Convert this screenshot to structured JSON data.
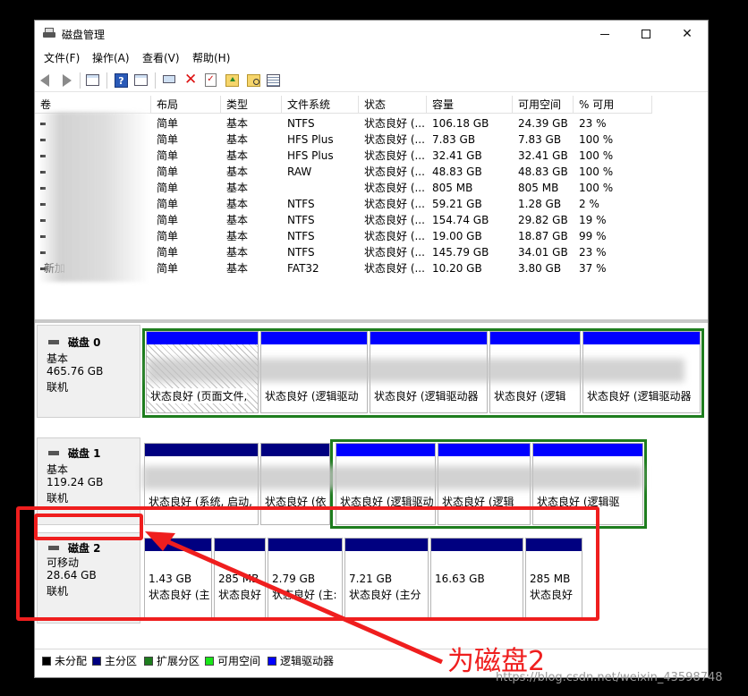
{
  "window": {
    "title": "磁盘管理"
  },
  "menu": [
    "文件(F)",
    "操作(A)",
    "查看(V)",
    "帮助(H)"
  ],
  "toolbar": [
    "back-icon",
    "forward-icon",
    "console-tree-icon",
    "help-icon",
    "properties-icon",
    "connect-icon",
    "delete-icon",
    "check-icon",
    "folder-up-icon",
    "folder-search-icon",
    "list-icon"
  ],
  "columns": [
    "卷",
    "布局",
    "类型",
    "文件系统",
    "状态",
    "容量",
    "可用空间",
    "% 可用"
  ],
  "volumes": [
    {
      "name": "",
      "layout": "简单",
      "type": "基本",
      "fs": "NTFS",
      "status": "状态良好 (...",
      "capacity": "106.18 GB",
      "free": "24.39 GB",
      "pct": "23 %"
    },
    {
      "name": "",
      "layout": "简单",
      "type": "基本",
      "fs": "HFS Plus",
      "status": "状态良好 (...",
      "capacity": "7.83 GB",
      "free": "7.83 GB",
      "pct": "100 %"
    },
    {
      "name": "",
      "layout": "简单",
      "type": "基本",
      "fs": "HFS Plus",
      "status": "状态良好 (...",
      "capacity": "32.41 GB",
      "free": "32.41 GB",
      "pct": "100 %"
    },
    {
      "name": "",
      "layout": "简单",
      "type": "基本",
      "fs": "RAW",
      "status": "状态良好 (...",
      "capacity": "48.83 GB",
      "free": "48.83 GB",
      "pct": "100 %"
    },
    {
      "name": "",
      "layout": "简单",
      "type": "基本",
      "fs": "",
      "status": "状态良好 (...",
      "capacity": "805 MB",
      "free": "805 MB",
      "pct": "100 %"
    },
    {
      "name": "",
      "layout": "简单",
      "type": "基本",
      "fs": "NTFS",
      "status": "状态良好 (...",
      "capacity": "59.21 GB",
      "free": "1.28 GB",
      "pct": "2 %"
    },
    {
      "name": "",
      "layout": "简单",
      "type": "基本",
      "fs": "NTFS",
      "status": "状态良好 (...",
      "capacity": "154.74 GB",
      "free": "29.82 GB",
      "pct": "19 %"
    },
    {
      "name": "",
      "layout": "简单",
      "type": "基本",
      "fs": "NTFS",
      "status": "状态良好 (...",
      "capacity": "19.00 GB",
      "free": "18.87 GB",
      "pct": "99 %"
    },
    {
      "name": "",
      "layout": "简单",
      "type": "基本",
      "fs": "NTFS",
      "status": "状态良好 (...",
      "capacity": "145.79 GB",
      "free": "34.01 GB",
      "pct": "23 %"
    },
    {
      "name": "新加",
      "layout": "简单",
      "type": "基本",
      "fs": "FAT32",
      "status": "状态良好 (...",
      "capacity": "10.20 GB",
      "free": "3.80 GB",
      "pct": "37 %"
    }
  ],
  "disks": [
    {
      "name": "磁盘 0",
      "type": "基本",
      "size": "465.76 GB",
      "state": "联机",
      "partitions": [
        {
          "size": "",
          "status": "状态良好 (页面文件,"
        },
        {
          "size": "",
          "status": "状态良好 (逻辑驱动"
        },
        {
          "size": "",
          "status": "状态良好 (逻辑驱动器"
        },
        {
          "size": "",
          "status": "状态良好 (逻辑"
        },
        {
          "size": "",
          "status": "状态良好 (逻辑驱动器"
        }
      ]
    },
    {
      "name": "磁盘 1",
      "type": "基本",
      "size": "119.24 GB",
      "state": "联机",
      "partitions": [
        {
          "size": "",
          "status": "状态良好 (系统, 启动,"
        },
        {
          "size": "",
          "status": "状态良好 (依"
        },
        {
          "size": "",
          "status": "状态良好 (逻辑驱动"
        },
        {
          "size": "",
          "status": "状态良好 (逻辑"
        },
        {
          "size": "",
          "status": "状态良好 (逻辑驱"
        }
      ]
    },
    {
      "name": "磁盘 2",
      "type": "可移动",
      "size": "28.64 GB",
      "state": "联机",
      "partitions": [
        {
          "size": "1.43 GB",
          "status": "状态良好 (主"
        },
        {
          "size": "285 MB",
          "status": "状态良好"
        },
        {
          "size": "2.79 GB",
          "status": "状态良好 (主:"
        },
        {
          "size": "7.21 GB",
          "status": "状态良好 (主分"
        },
        {
          "size": "16.63 GB",
          "status": ""
        },
        {
          "size": "285 MB",
          "status": "状态良好"
        }
      ]
    }
  ],
  "legend": [
    {
      "label": "未分配",
      "color": "#000000"
    },
    {
      "label": "主分区",
      "color": "#000080"
    },
    {
      "label": "扩展分区",
      "color": "#1e7d1e"
    },
    {
      "label": "可用空间",
      "color": "#19e619"
    },
    {
      "label": "逻辑驱动器",
      "color": "#0000ff"
    }
  ],
  "annotation": {
    "text": "为磁盘2"
  },
  "watermark": "https://blog.csdn.net/weixin_43598748",
  "colors": {
    "primary": "#000080",
    "logical": "#0000ff",
    "extended": "#1e7d1e",
    "annotation": "#ef1e1e"
  }
}
